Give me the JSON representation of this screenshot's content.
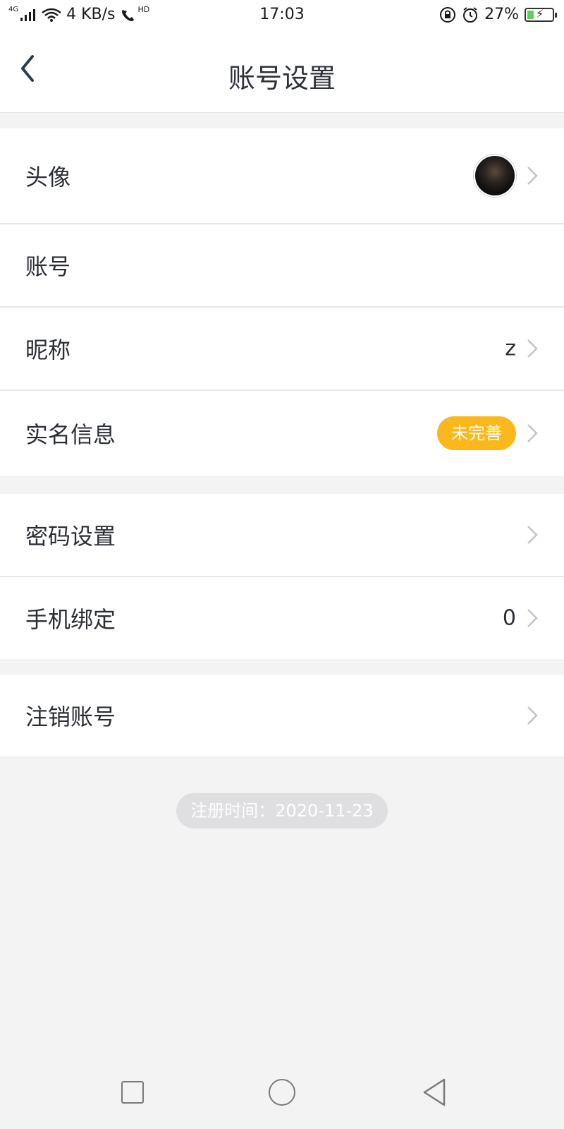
{
  "status_bar": {
    "network_tag": "4G",
    "speed": "4 KB/s",
    "hd_label": "HD",
    "time": "17:03",
    "battery": "27%",
    "battery_level": 0.27
  },
  "header": {
    "title": "账号设置"
  },
  "settings": {
    "group1": [
      {
        "label": "头像"
      },
      {
        "label": "账号"
      },
      {
        "label": "昵称",
        "value": "z"
      },
      {
        "label": "实名信息",
        "badge": "未完善"
      }
    ],
    "group2": [
      {
        "label": "密码设置"
      },
      {
        "label": "手机绑定",
        "value": "0"
      }
    ],
    "group3": [
      {
        "label": "注销账号"
      }
    ]
  },
  "registration": {
    "text": "注册时间：2020-11-23"
  },
  "colors": {
    "badge_bg": "#fbb81c",
    "page_bg": "#f3f3f4",
    "text": "#2b2e35"
  }
}
